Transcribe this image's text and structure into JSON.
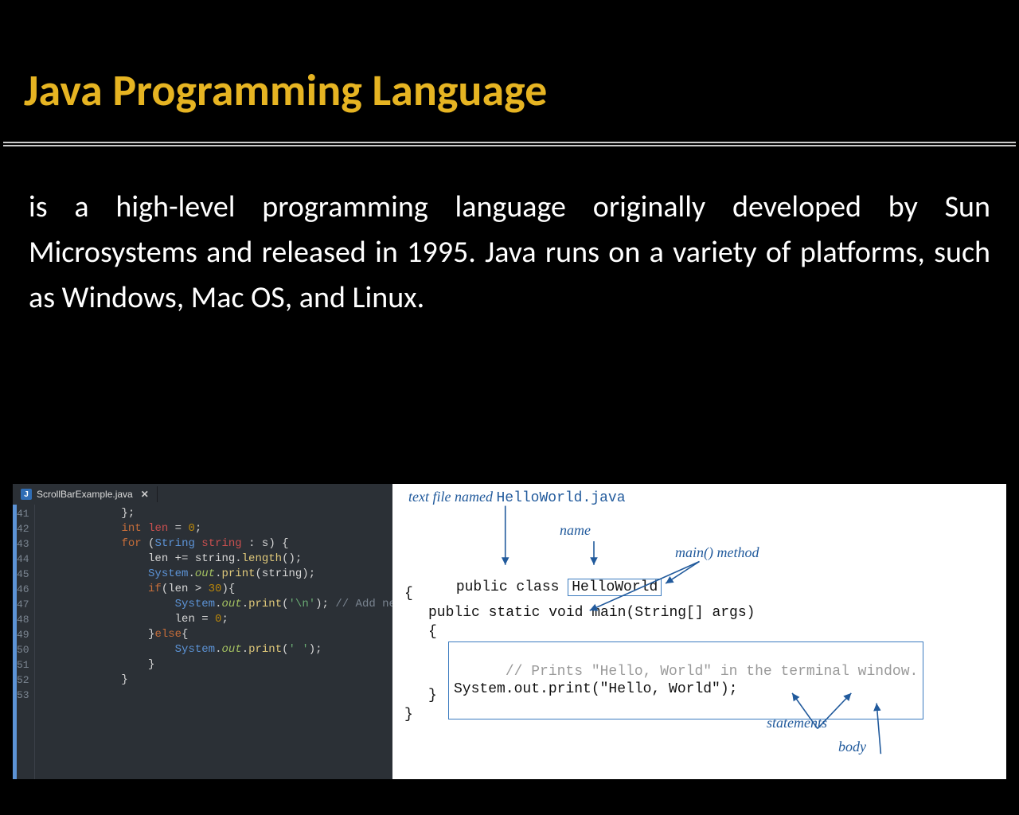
{
  "title": "Java Programming Language",
  "body_text": "is a high-level programming language originally developed by Sun Microsystems and released in 1995. Java runs on a variety of platforms, such as Windows, Mac OS, and Linux.",
  "editor": {
    "tab_icon": "J",
    "tab_name": "ScrollBarExample.java",
    "close_glyph": "✕",
    "lines": [
      {
        "num": "41",
        "segs": [
          [
            "            };",
            "punc"
          ]
        ]
      },
      {
        "num": "42",
        "segs": [
          [
            "            ",
            "plain"
          ],
          [
            "int",
            "type"
          ],
          [
            " ",
            "plain"
          ],
          [
            "len",
            "var"
          ],
          [
            " = ",
            "punc"
          ],
          [
            "0",
            "num"
          ],
          [
            ";",
            "punc"
          ]
        ]
      },
      {
        "num": "43",
        "segs": [
          [
            "            ",
            "plain"
          ],
          [
            "for",
            "kw"
          ],
          [
            " (",
            "punc"
          ],
          [
            "String",
            "cls"
          ],
          [
            " ",
            "plain"
          ],
          [
            "string",
            "var"
          ],
          [
            " : s) {",
            "punc"
          ]
        ]
      },
      {
        "num": "44",
        "segs": [
          [
            "                len += string.",
            "plain"
          ],
          [
            "length",
            "method"
          ],
          [
            "();",
            "punc"
          ]
        ]
      },
      {
        "num": "45",
        "segs": [
          [
            "                ",
            "plain"
          ],
          [
            "System",
            "cls"
          ],
          [
            ".",
            "punc"
          ],
          [
            "out",
            "field"
          ],
          [
            ".",
            "punc"
          ],
          [
            "print",
            "method"
          ],
          [
            "(string);",
            "punc"
          ]
        ]
      },
      {
        "num": "46",
        "segs": [
          [
            "                ",
            "plain"
          ],
          [
            "if",
            "kw"
          ],
          [
            "(len > ",
            "punc"
          ],
          [
            "30",
            "num"
          ],
          [
            "){",
            "punc"
          ]
        ]
      },
      {
        "num": "47",
        "segs": [
          [
            "                    ",
            "plain"
          ],
          [
            "System",
            "cls"
          ],
          [
            ".",
            "punc"
          ],
          [
            "out",
            "field"
          ],
          [
            ".",
            "punc"
          ],
          [
            "print",
            "method"
          ],
          [
            "(",
            "punc"
          ],
          [
            "'\\n'",
            "str"
          ],
          [
            "); ",
            "punc"
          ],
          [
            "// Add ne",
            "cmt"
          ]
        ]
      },
      {
        "num": "48",
        "segs": [
          [
            "                    len = ",
            "plain"
          ],
          [
            "0",
            "num"
          ],
          [
            ";",
            "punc"
          ]
        ]
      },
      {
        "num": "49",
        "segs": [
          [
            "                }",
            "punc"
          ],
          [
            "else",
            "kw"
          ],
          [
            "{",
            "punc"
          ]
        ]
      },
      {
        "num": "50",
        "segs": [
          [
            "                    ",
            "plain"
          ],
          [
            "System",
            "cls"
          ],
          [
            ".",
            "punc"
          ],
          [
            "out",
            "field"
          ],
          [
            ".",
            "punc"
          ],
          [
            "print",
            "method"
          ],
          [
            "(",
            "punc"
          ],
          [
            "' '",
            "str"
          ],
          [
            ");",
            "punc"
          ]
        ]
      },
      {
        "num": "51",
        "segs": [
          [
            "                }",
            "punc"
          ]
        ]
      },
      {
        "num": "52",
        "segs": [
          [
            "            }",
            "punc"
          ]
        ]
      },
      {
        "num": "53",
        "segs": [
          [
            "",
            "plain"
          ]
        ]
      }
    ]
  },
  "diagram": {
    "label_file_prefix": "text file named ",
    "label_file_name": "HelloWorld.java",
    "label_name": "name",
    "label_main": "main() method",
    "label_statements": "statements",
    "label_body": "body",
    "code_public_class": "public class",
    "code_class_name": "HelloWorld",
    "brace_open": "{",
    "brace_close": "}",
    "code_main_decl": "public static void main(String[] args)",
    "code_comment": "// Prints \"Hello, World\" in the terminal window.",
    "code_stmt": "System.out.print(\"Hello, World\");"
  }
}
